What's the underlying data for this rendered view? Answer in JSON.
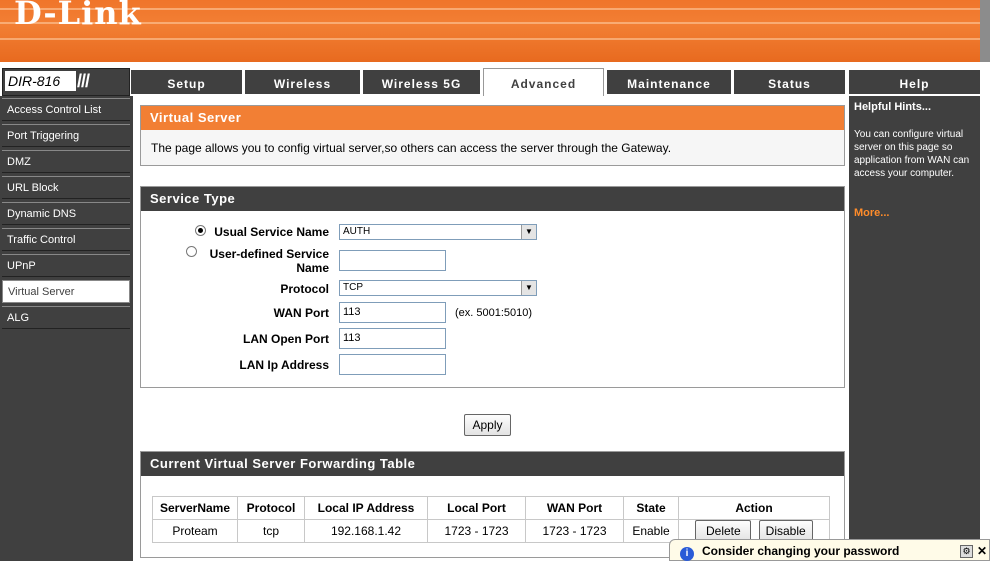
{
  "brand": {
    "logo": "D-Link",
    "model": "DIR-816",
    "slashes": "///"
  },
  "tabs": [
    {
      "label": "Setup"
    },
    {
      "label": "Wireless"
    },
    {
      "label": "Wireless 5G"
    },
    {
      "label": "Advanced"
    },
    {
      "label": "Maintenance"
    },
    {
      "label": "Status"
    },
    {
      "label": "Help"
    }
  ],
  "sidebar": {
    "items": [
      {
        "label": "Access Control List"
      },
      {
        "label": "Port Triggering"
      },
      {
        "label": "DMZ"
      },
      {
        "label": "URL Block"
      },
      {
        "label": "Dynamic DNS"
      },
      {
        "label": "Traffic Control"
      },
      {
        "label": "UPnP"
      },
      {
        "label": "Virtual Server"
      },
      {
        "label": "ALG"
      }
    ]
  },
  "intro": {
    "title": "Virtual Server",
    "text": "The page allows you to config virtual server,so others can access the server through the Gateway."
  },
  "service": {
    "title": "Service Type",
    "usual_label": "Usual Service Name",
    "usual_value": "AUTH",
    "user_defined_label_1": "User-defined Service",
    "user_defined_label_2": "Name",
    "user_defined_value": "",
    "protocol_label": "Protocol",
    "protocol_value": "TCP",
    "wan_port_label": "WAN Port",
    "wan_port_value": "113",
    "wan_port_hint": "(ex. 5001:5010)",
    "lan_port_label": "LAN Open Port",
    "lan_port_value": "113",
    "lan_ip_label": "LAN Ip Address",
    "lan_ip_value": ""
  },
  "apply_label": "Apply",
  "table": {
    "title": "Current Virtual Server Forwarding Table",
    "headers": [
      "ServerName",
      "Protocol",
      "Local IP Address",
      "Local Port",
      "WAN Port",
      "State",
      "Action"
    ],
    "rows": [
      {
        "server": "Proteam",
        "protocol": "tcp",
        "ip": "192.168.1.42",
        "local_port": "1723 - 1723",
        "wan_port": "1723 - 1723",
        "state": "Enable",
        "delete": "Delete",
        "disable": "Disable"
      }
    ]
  },
  "hints": {
    "title": "Helpful Hints...",
    "text": "You can configure virtual server on this page so application from WAN can access your computer.",
    "more": "More..."
  },
  "notification": {
    "text": "Consider changing your password",
    "icon": "info-icon"
  },
  "colors": {
    "orange": "#f27f34",
    "dark": "#404040"
  }
}
